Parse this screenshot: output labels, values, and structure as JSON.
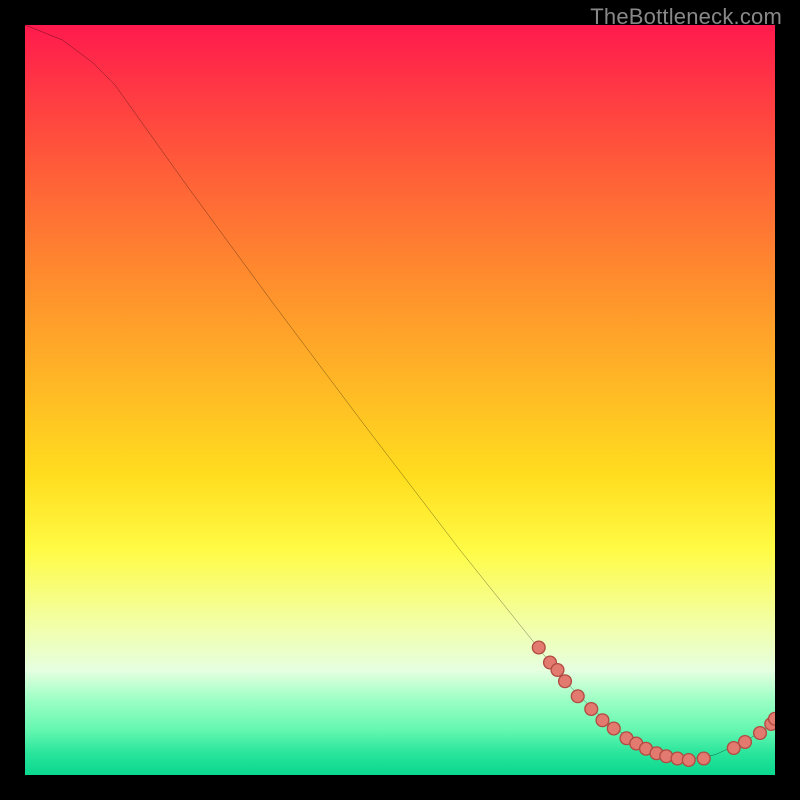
{
  "watermark": "TheBottleneck.com",
  "colors": {
    "background": "#000000",
    "watermark": "#888888",
    "curve": "#000000",
    "dot_fill": "#e27a70",
    "dot_stroke": "#b24b42",
    "gradient_stops": [
      "#ff1a4d",
      "#ff593a",
      "#ff8a2e",
      "#ffb526",
      "#ffdd1e",
      "#fffb45",
      "#f2ffa8",
      "#e6ffe0",
      "#9cffc4",
      "#64f7b0",
      "#2be59c",
      "#09d88e"
    ]
  },
  "chart_data": {
    "type": "line",
    "title": "",
    "xlabel": "",
    "ylabel": "",
    "x_range": [
      0,
      100
    ],
    "y_range": [
      0,
      100
    ],
    "curve_xy": [
      [
        0,
        100
      ],
      [
        5,
        98
      ],
      [
        9,
        95
      ],
      [
        12,
        92
      ],
      [
        22,
        78
      ],
      [
        33,
        63
      ],
      [
        45,
        47
      ],
      [
        58,
        30
      ],
      [
        68,
        17.5
      ],
      [
        72,
        12.5
      ],
      [
        76,
        8.5
      ],
      [
        79,
        6
      ],
      [
        82,
        4
      ],
      [
        85,
        2.5
      ],
      [
        88,
        2
      ],
      [
        92,
        2.7
      ],
      [
        96,
        4.5
      ],
      [
        98.5,
        6
      ],
      [
        100,
        7.5
      ]
    ],
    "dots_xy": [
      [
        68.5,
        17
      ],
      [
        70,
        15
      ],
      [
        71,
        14
      ],
      [
        72,
        12.5
      ],
      [
        73.7,
        10.5
      ],
      [
        75.5,
        8.8
      ],
      [
        77,
        7.3
      ],
      [
        78.5,
        6.2
      ],
      [
        80.2,
        4.9
      ],
      [
        81.5,
        4.2
      ],
      [
        82.8,
        3.5
      ],
      [
        84.2,
        2.9
      ],
      [
        85.5,
        2.5
      ],
      [
        87,
        2.2
      ],
      [
        88.5,
        2.0
      ],
      [
        90.5,
        2.2
      ],
      [
        94.5,
        3.6
      ],
      [
        96,
        4.4
      ],
      [
        98,
        5.6
      ],
      [
        99.5,
        6.8
      ],
      [
        100,
        7.5
      ]
    ]
  }
}
